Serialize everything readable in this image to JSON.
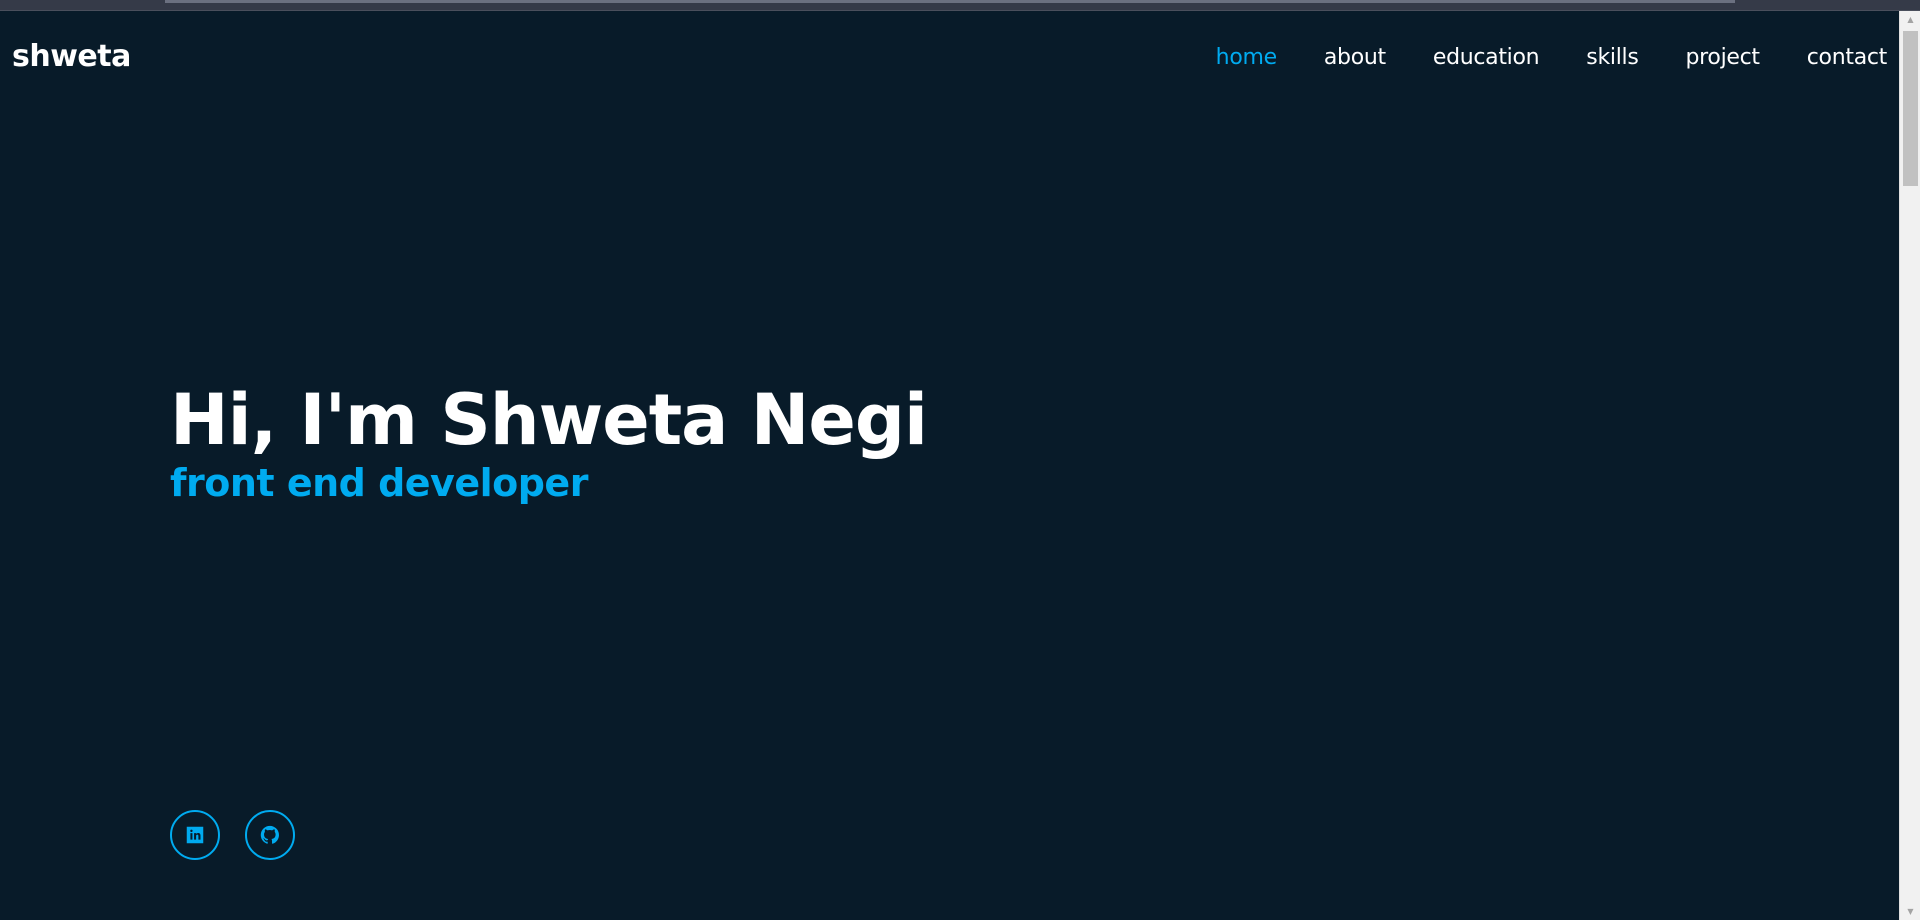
{
  "header": {
    "logo": "shweta",
    "nav": [
      {
        "label": "home",
        "active": true
      },
      {
        "label": "about",
        "active": false
      },
      {
        "label": "education",
        "active": false
      },
      {
        "label": "skills",
        "active": false
      },
      {
        "label": "project",
        "active": false
      },
      {
        "label": "contact",
        "active": false
      }
    ]
  },
  "hero": {
    "title": "Hi, I'm Shweta Negi",
    "subtitle": "front end developer"
  },
  "social": [
    {
      "icon": "linkedin-icon"
    },
    {
      "icon": "github-icon"
    }
  ],
  "colors": {
    "background": "#081b29",
    "accent": "#00abf0",
    "text": "#ffffff"
  }
}
